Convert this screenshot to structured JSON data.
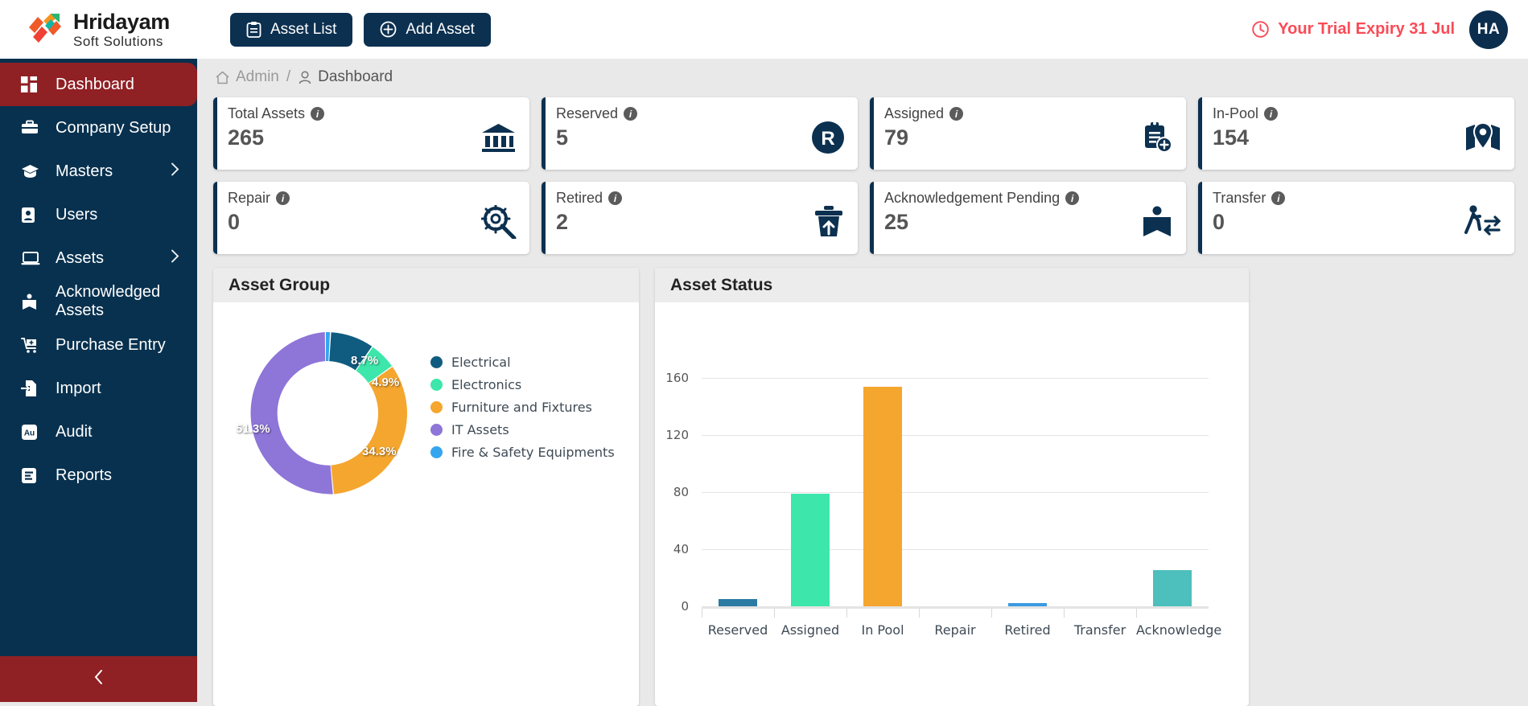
{
  "header": {
    "brand_title": "Hridayam",
    "brand_sub": "Soft  Solutions",
    "buttons": [
      {
        "label": "Asset List",
        "icon": "clipboard-icon"
      },
      {
        "label": "Add Asset",
        "icon": "plus-circle-icon"
      }
    ],
    "trial_text": "Your Trial Expiry 31 Jul",
    "trial_icon": "clock-icon",
    "avatar_initials": "HA",
    "trial_color": "#fa4b57"
  },
  "sidebar": {
    "bg_color": "#08314f",
    "active_color": "#8f2024",
    "items": [
      {
        "label": "Dashboard",
        "icon": "grid-icon",
        "active": true,
        "chevron": false
      },
      {
        "label": "Company Setup",
        "icon": "briefcase-icon",
        "active": false,
        "chevron": false
      },
      {
        "label": "Masters",
        "icon": "graduation-icon",
        "active": false,
        "chevron": true
      },
      {
        "label": "Users",
        "icon": "user-card-icon",
        "active": false,
        "chevron": false
      },
      {
        "label": "Assets",
        "icon": "laptop-icon",
        "active": false,
        "chevron": true
      },
      {
        "label": "Acknowledged Assets",
        "icon": "book-icon",
        "active": false,
        "chevron": false
      },
      {
        "label": "Purchase Entry",
        "icon": "cart-plus-icon",
        "active": false,
        "chevron": false
      },
      {
        "label": "Import",
        "icon": "file-import-icon",
        "active": false,
        "chevron": false
      },
      {
        "label": "Audit",
        "icon": "au-badge-icon",
        "active": false,
        "chevron": false
      },
      {
        "label": "Reports",
        "icon": "report-icon",
        "active": false,
        "chevron": false
      }
    ],
    "collapse_icon": "chevron-left-icon"
  },
  "breadcrumb": {
    "home_icon": "home-icon",
    "root": "Admin",
    "separator": "/",
    "person_icon": "person-icon",
    "current": "Dashboard"
  },
  "cards": [
    {
      "label": "Total Assets",
      "value": "265",
      "icon": "bank-icon"
    },
    {
      "label": "Reserved",
      "value": "5",
      "icon": "r-circle-icon"
    },
    {
      "label": "Assigned",
      "value": "79",
      "icon": "clipboard-plus-icon"
    },
    {
      "label": "In-Pool",
      "value": "154",
      "icon": "map-pin-icon"
    },
    {
      "label": "Repair",
      "value": "0",
      "icon": "gear-wrench-icon"
    },
    {
      "label": "Retired",
      "value": "2",
      "icon": "trash-upload-icon"
    },
    {
      "label": "Acknowledgement Pending",
      "value": "25",
      "icon": "open-book-icon"
    },
    {
      "label": "Transfer",
      "value": "0",
      "icon": "person-transfer-icon"
    }
  ],
  "panels": {
    "asset_group_title": "Asset Group",
    "asset_status_title": "Asset Status"
  },
  "chart_data": [
    {
      "type": "pie",
      "title": "Asset Group",
      "variant": "donut",
      "legend_position": "right",
      "labels": [
        "Electrical",
        "Electronics",
        "Furniture and Fixtures",
        "IT Assets",
        "Fire & Safety Equipments"
      ],
      "values": [
        8.7,
        4.9,
        34.3,
        51.3,
        0.8
      ],
      "value_labels": [
        "8.7%",
        "4.9%",
        "34.3%",
        "51.3%",
        ""
      ],
      "colors": [
        "#0f5c80",
        "#3de6ab",
        "#f5a62e",
        "#8e75d8",
        "#35a5f0"
      ]
    },
    {
      "type": "bar",
      "title": "Asset Status",
      "categories": [
        "Reserved",
        "Assigned",
        "In Pool",
        "Repair",
        "Retired",
        "Transfer",
        "Acknowledge"
      ],
      "values": [
        5,
        79,
        154,
        0,
        2,
        0,
        25
      ],
      "colors": [
        "#2b7ba3",
        "#3de6ab",
        "#f5a62e",
        "#f5a62e",
        "#3b9ae1",
        "#3de6ab",
        "#4dbfbd"
      ],
      "ylabel": "",
      "xlabel": "",
      "yticks": [
        0,
        40,
        80,
        120,
        160
      ],
      "ylim": [
        0,
        175
      ],
      "grid": true
    }
  ]
}
